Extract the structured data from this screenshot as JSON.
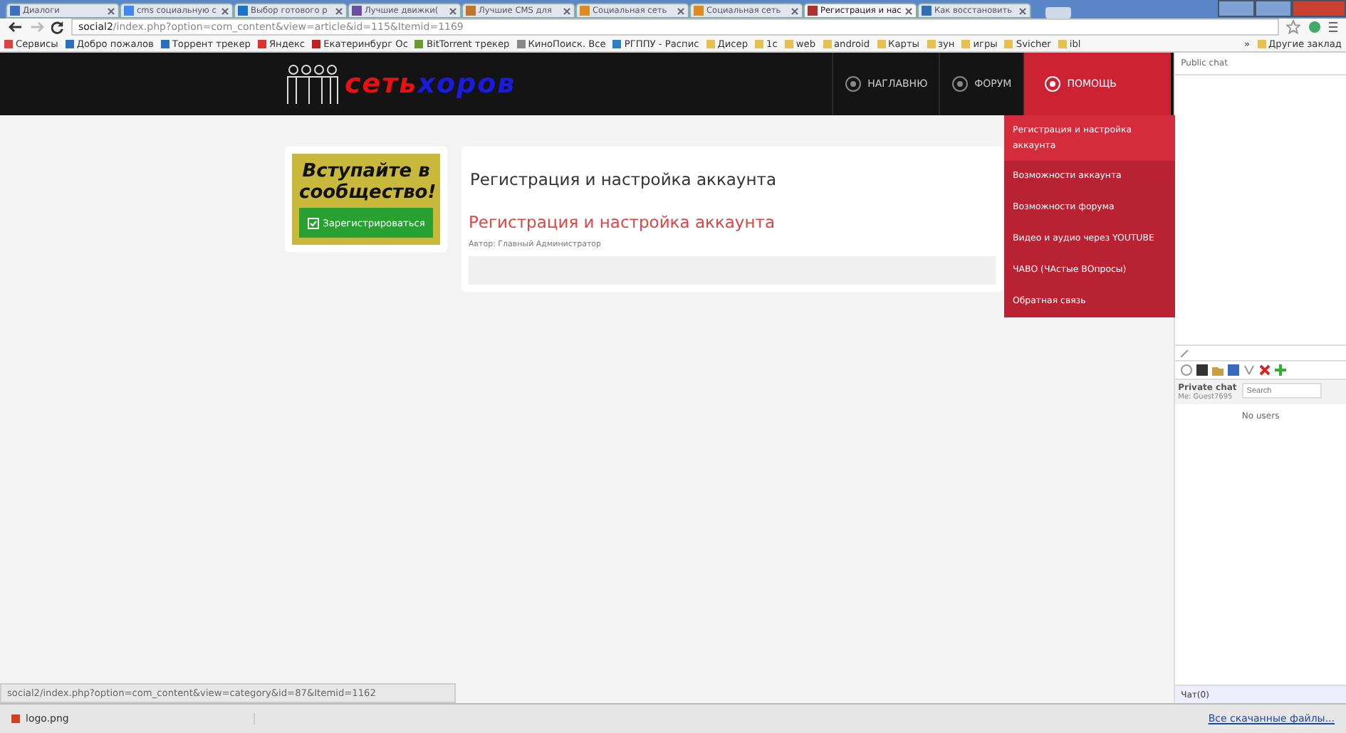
{
  "browser": {
    "tabs": [
      {
        "label": "Диалоги",
        "selected": false,
        "color": "#3b6fc4"
      },
      {
        "label": "cms социальную с",
        "selected": false,
        "color": "#4285f4"
      },
      {
        "label": "Выбор готового р",
        "selected": false,
        "color": "#1a73c8"
      },
      {
        "label": "Лучшие движки(",
        "selected": false,
        "color": "#6a4fa0"
      },
      {
        "label": "Лучшие CMS для",
        "selected": false,
        "color": "#c0762a"
      },
      {
        "label": "Социальная сеть",
        "selected": false,
        "color": "#e08a1e"
      },
      {
        "label": "Социальная сеть",
        "selected": false,
        "color": "#e08a1e"
      },
      {
        "label": "Регистрация и нас",
        "selected": true,
        "color": "#b03030"
      },
      {
        "label": "Как восстановить",
        "selected": false,
        "color": "#2d6fb8"
      }
    ],
    "url_host": "social2",
    "url_path": "/index.php?option=com_content&view=article&id=115&Itemid=1169",
    "bookmarks": [
      {
        "label": "Сервисы",
        "color": "#e04040"
      },
      {
        "label": "Добро пожалов",
        "color": "#2a6fc0"
      },
      {
        "label": "Торрент трекер",
        "color": "#2a6fc0"
      },
      {
        "label": "Яндекс",
        "color": "#e03030"
      },
      {
        "label": "Екатеринбург Ос",
        "color": "#c02020"
      },
      {
        "label": "BitTorrent трекер",
        "color": "#6a9a30"
      },
      {
        "label": "КиноПоиск. Все",
        "color": "#888888"
      },
      {
        "label": "РГППУ - Распис",
        "color": "#2a80c0"
      },
      {
        "label": "Дисер",
        "color": "#e8c050"
      },
      {
        "label": "1с",
        "color": "#e8c050"
      },
      {
        "label": "web",
        "color": "#e8c050"
      },
      {
        "label": "android",
        "color": "#e8c050"
      },
      {
        "label": "Карты",
        "color": "#e8c050"
      },
      {
        "label": "зун",
        "color": "#e8c050"
      },
      {
        "label": "игры",
        "color": "#e8c050"
      },
      {
        "label": "Svicher",
        "color": "#e8c050"
      },
      {
        "label": "ibl",
        "color": "#e8c050"
      }
    ],
    "more": "»",
    "other_bookmarks": "Другие заклад"
  },
  "site": {
    "logo": {
      "part1": "сеть",
      "part2": "хоров"
    },
    "nav": [
      {
        "label": "НАГЛАВНЮ",
        "selected": false
      },
      {
        "label": "ФОРУМ",
        "selected": false
      },
      {
        "label": "ПОМОЩЬ",
        "selected": true
      }
    ],
    "help_menu": [
      {
        "label": "Регистрация и настройка аккаунта",
        "selected": true
      },
      {
        "label": "Возможности аккаунта",
        "selected": false
      },
      {
        "label": "Возможности форума",
        "selected": false
      },
      {
        "label": "Видео и аудио через YOUTUBE",
        "selected": false
      },
      {
        "label": "ЧАВО (ЧАстые ВОпросы)",
        "selected": false
      },
      {
        "label": "Обратная связь",
        "selected": false
      }
    ],
    "promo": {
      "title": "Вступайте в сообщество!",
      "button": "Зарегистрироваться"
    },
    "article": {
      "breadcrumb_title": "Регистрация и настройка аккаунта",
      "title": "Регистрация и настройка аккаунта",
      "author": "Автор: Главный Администратор"
    },
    "status_url": "social2/index.php?option=com_content&view=category&id=87&Itemid=1162"
  },
  "chat": {
    "public_title": "Public chat",
    "private_title": "Private chat",
    "me": "Me: Guest7695",
    "search_placeholder": "Search",
    "empty": "No users",
    "footer": "Чат(0)"
  },
  "downloads": {
    "file": "logo.png",
    "all": "Все скачанные файлы..."
  }
}
